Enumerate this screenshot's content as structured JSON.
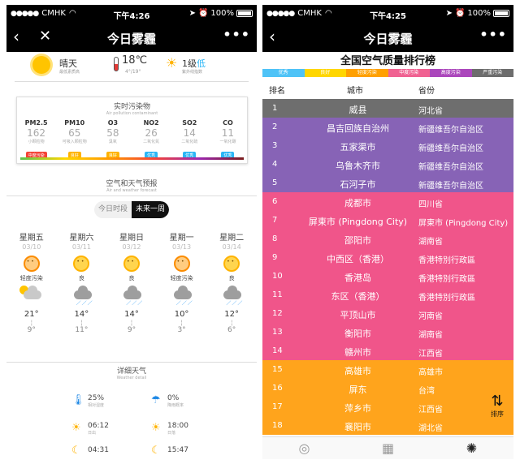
{
  "status_left": {
    "carrier": "CMHK",
    "time": "下午4:26",
    "battery": "100%"
  },
  "status_right": {
    "carrier": "CMHK",
    "time": "下午4:25",
    "battery": "100%"
  },
  "left": {
    "title": "今日雾霾",
    "weather": {
      "condition": "晴天",
      "condition_note": "最低素质高",
      "temp": "18℃",
      "temp_range": "4°/19°",
      "wind": "1级",
      "wind_word": "低",
      "wind_note": "紫外线指数"
    },
    "pollution": {
      "title": "实时污染物",
      "subtitle": "Air pollution contaminant",
      "items": [
        {
          "name": "PM2.5",
          "value": "162",
          "desc": "小颗粒物",
          "level": "中度污染",
          "color": "#f44336"
        },
        {
          "name": "PM10",
          "value": "65",
          "desc": "可吸入颗粒物",
          "level": "良好",
          "color": "#ffb300"
        },
        {
          "name": "O3",
          "value": "58",
          "desc": "臭氧",
          "level": "良好",
          "color": "#ffb300"
        },
        {
          "name": "NO2",
          "value": "26",
          "desc": "二氧化氮",
          "level": "优秀",
          "color": "#29b6f6"
        },
        {
          "name": "SO2",
          "value": "14",
          "desc": "二氧化硫",
          "level": "优秀",
          "color": "#29b6f6"
        },
        {
          "name": "CO",
          "value": "11",
          "desc": "一氧化碳",
          "level": "优秀",
          "color": "#29b6f6"
        }
      ]
    },
    "forecast": {
      "title": "空气和天气预报",
      "subtitle": "Air and weather forecast",
      "toggle_hourly": "今日时段",
      "toggle_week": "未来一周",
      "days": [
        {
          "name": "星期五",
          "date": "03/10",
          "aqi": "轻度污染",
          "face": "bad",
          "icon": "sun-cloud-icon",
          "hi": "21°",
          "lo": "9°"
        },
        {
          "name": "星期六",
          "date": "03/11",
          "aqi": "良",
          "face": "ok",
          "icon": "rain-icon",
          "hi": "14°",
          "lo": "11°"
        },
        {
          "name": "星期日",
          "date": "03/12",
          "aqi": "良",
          "face": "ok",
          "icon": "rain-icon",
          "hi": "14°",
          "lo": "9°"
        },
        {
          "name": "星期一",
          "date": "03/13",
          "aqi": "轻度污染",
          "face": "bad",
          "icon": "rain-icon",
          "hi": "10°",
          "lo": "3°"
        },
        {
          "name": "星期二",
          "date": "03/14",
          "aqi": "良",
          "face": "ok",
          "icon": "rain-icon",
          "hi": "12°",
          "lo": "6°"
        }
      ]
    },
    "detail": {
      "title": "详细天气",
      "subtitle": "Weather detail",
      "humidity": "25%",
      "humidity_cap": "相对湿度",
      "rain_prob": "0%",
      "rain_prob_cap": "降雨概率",
      "sunrise": "06:12",
      "sunrise_cap": "日出",
      "sunset": "18:00",
      "sunset_cap": "日落",
      "moonrise": "04:31",
      "moonset": "15:47"
    }
  },
  "right": {
    "title": "今日雾霾",
    "rank_title": "全国空气质量排行榜",
    "legend": [
      {
        "label": "优秀",
        "color": "#4fc3f7"
      },
      {
        "label": "良好",
        "color": "#ffd600"
      },
      {
        "label": "轻度污染",
        "color": "#ffa000"
      },
      {
        "label": "中度污染",
        "color": "#f06292"
      },
      {
        "label": "高度污染",
        "color": "#ab47bc"
      },
      {
        "label": "严重污染",
        "color": "#6d6d6d"
      }
    ],
    "headers": {
      "rank": "排名",
      "city": "城市",
      "province": "省份"
    },
    "rows": [
      {
        "rank": "1",
        "city": "威县",
        "province": "河北省",
        "color": "#6e6e6e"
      },
      {
        "rank": "2",
        "city": "昌吉回族自治州",
        "province": "新疆维吾尔自治区",
        "color": "#8763b6"
      },
      {
        "rank": "3",
        "city": "五家渠市",
        "province": "新疆维吾尔自治区",
        "color": "#8763b6"
      },
      {
        "rank": "4",
        "city": "乌鲁木齐市",
        "province": "新疆维吾尔自治区",
        "color": "#8763b6"
      },
      {
        "rank": "5",
        "city": "石河子市",
        "province": "新疆维吾尔自治区",
        "color": "#8763b6"
      },
      {
        "rank": "6",
        "city": "成都市",
        "province": "四川省",
        "color": "#f0558a"
      },
      {
        "rank": "7",
        "city": "屏東市 (Pingdong City)",
        "province": "屏東市 (Pingdong City)",
        "color": "#f0558a"
      },
      {
        "rank": "8",
        "city": "邵阳市",
        "province": "湖南省",
        "color": "#f0558a"
      },
      {
        "rank": "9",
        "city": "中西区（香港）",
        "province": "香港特別行政區",
        "color": "#f0558a"
      },
      {
        "rank": "10",
        "city": "香港岛",
        "province": "香港特別行政區",
        "color": "#f0558a"
      },
      {
        "rank": "11",
        "city": "东区（香港）",
        "province": "香港特別行政區",
        "color": "#f0558a"
      },
      {
        "rank": "12",
        "city": "平顶山市",
        "province": "河南省",
        "color": "#f0558a"
      },
      {
        "rank": "13",
        "city": "衡阳市",
        "province": "湖南省",
        "color": "#f0558a"
      },
      {
        "rank": "14",
        "city": "赣州市",
        "province": "江西省",
        "color": "#f0558a"
      },
      {
        "rank": "15",
        "city": "高雄市",
        "province": "高雄市",
        "color": "#ffa41c"
      },
      {
        "rank": "16",
        "city": "屏东",
        "province": "台湾",
        "color": "#ffa41c"
      },
      {
        "rank": "17",
        "city": "萍乡市",
        "province": "江西省",
        "color": "#ffa41c"
      },
      {
        "rank": "18",
        "city": "襄阳市",
        "province": "湖北省",
        "color": "#ffa41c"
      }
    ],
    "sort_label": "排序",
    "tabs": [
      "person-pin-icon",
      "map-icon",
      "bulb-icon"
    ]
  }
}
